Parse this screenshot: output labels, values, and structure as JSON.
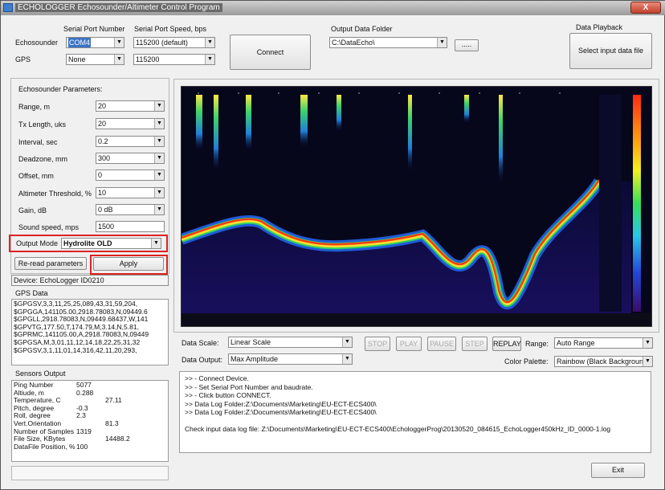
{
  "window": {
    "title": "ECHOLOGGER Echosounder/Altimeter Control Program",
    "close_label": "X"
  },
  "connection": {
    "serial_port_number_header": "Serial Port Number",
    "serial_port_speed_header": "Serial Port Speed, bps",
    "echosounder_label": "Echosounder",
    "gps_label": "GPS",
    "echosounder_port": "COM4",
    "gps_port": "None",
    "echosounder_speed": "115200 (default)",
    "gps_speed": "115200",
    "connect_label": "Connect"
  },
  "output_folder": {
    "label": "Output Data Folder",
    "value": "C:\\DataEcho\\",
    "browse_label": "....."
  },
  "playback": {
    "label": "Data Playback",
    "button_label": "Select input data file"
  },
  "params": {
    "header": "Echosounder Parameters:",
    "rows": [
      {
        "label": "Range, m",
        "value": "20"
      },
      {
        "label": "Tx Length, uks",
        "value": "20"
      },
      {
        "label": "Interval, sec",
        "value": "0.2"
      },
      {
        "label": "Deadzone, mm",
        "value": "300"
      },
      {
        "label": "Offset, mm",
        "value": "0"
      },
      {
        "label": "Altimeter Threshold, %",
        "value": "10"
      },
      {
        "label": "Gain, dB",
        "value": "0 dB"
      }
    ],
    "sound_speed_label": "Sound speed, mps",
    "sound_speed_value": "1500",
    "output_mode_label": "Output Mode",
    "output_mode_value": "Hydrolite OLD",
    "reread_label": "Re-read parameters",
    "apply_label": "Apply",
    "device_text": "Device: EchoLogger ID0210"
  },
  "gps": {
    "header": "GPS Data",
    "lines": [
      "$GPGSV,3,3,11,25,25,089,43,31,59,204,",
      "$GPGGA,141105.00,2918.78083,N,09449.6",
      "$GPGLL,2918.78083,N,09449.68437,W,141",
      "$GPVTG,177.50,T,174.79,M,3.14,N,5.81,",
      "$GPRMC,141105.00,A,2918.78083,N,09449",
      "$GPGSA,M,3,01,11,12,14,18,22,25,31,32",
      "$GPGSV,3,1,11,01,14,316,42,11,20,293,"
    ]
  },
  "sensors": {
    "header": "Sensors Output",
    "rows": [
      {
        "k": "Ping Number",
        "v": "5077",
        "v2": ""
      },
      {
        "k": "Altiude, m",
        "v": "0.288",
        "v2": ""
      },
      {
        "k": "Temperature, C",
        "v": "",
        "v2": "27.11"
      },
      {
        "k": "Pitch, degree",
        "v": "-0.3",
        "v2": ""
      },
      {
        "k": "Roll, degree",
        "v": "2.3",
        "v2": ""
      },
      {
        "k": "Vert.Orientation",
        "v": "",
        "v2": "81.3"
      },
      {
        "k": "Number of Samples",
        "v": "1319",
        "v2": ""
      },
      {
        "k": "File Size, KBytes",
        "v": "",
        "v2": "14488.2"
      },
      {
        "k": "DataFile Position, %",
        "v": "100",
        "v2": ""
      }
    ]
  },
  "display": {
    "data_scale_label": "Data Scale:",
    "data_scale_value": "Linear Scale",
    "data_output_label": "Data Output:",
    "data_output_value": "Max  Amplitude",
    "stop_label": "STOP",
    "play_label": "PLAY",
    "pause_label": "PAUSE",
    "step_label": "STEP",
    "replay_label": "REPLAY",
    "range_label": "Range:",
    "range_value": "Auto Range",
    "palette_label": "Color Palette:",
    "palette_value": "Rainbow (Black Backgroun"
  },
  "log": {
    "lines": [
      ">> - Connect Device.",
      ">> - Set Serial Port Number and baudrate.",
      ">> - Click button CONNECT.",
      ">> Data Log Folder:Z:\\Documents\\Marketing\\EU-ECT-ECS400\\",
      ">> Data Log Folder:Z:\\Documents\\Marketing\\EU-ECT-ECS400\\",
      "",
      "Check input data log file: Z:\\Documents\\Marketing\\EU-ECT-ECS400\\EchologgerProg\\20130520_084615_EchoLogger450kHz_ID_0000-1.log"
    ]
  },
  "exit_label": "Exit",
  "colors": {
    "highlight": "#d22222",
    "selection": "#3b73c6",
    "echo_bg": "#050510"
  }
}
